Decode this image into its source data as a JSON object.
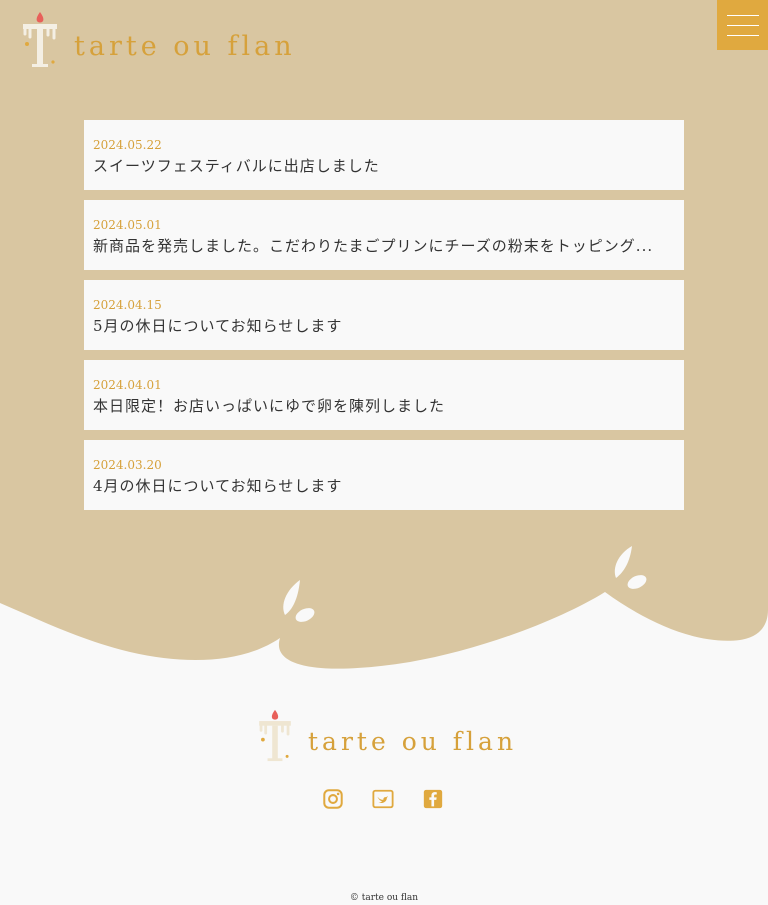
{
  "brand": {
    "name": "tarte ou flan",
    "accent": "#e0a93f",
    "gold_text": "#d6a13b",
    "background": "#d9c6a1",
    "footer_background": "#f9f9f9"
  },
  "header": {
    "menu_icon": "hamburger-icon"
  },
  "news": {
    "items": [
      {
        "date": "2024.05.22",
        "title": "スイーツフェスティバルに出店しました"
      },
      {
        "date": "2024.05.01",
        "title": "新商品を発売しました。こだわりたまごプリンにチーズの粉末をトッピング..."
      },
      {
        "date": "2024.04.15",
        "title": "5月の休日についてお知らせします"
      },
      {
        "date": "2024.04.01",
        "title": "本日限定！お店いっぱいにゆで卵を陳列しました"
      },
      {
        "date": "2024.03.20",
        "title": "4月の休日についてお知らせします"
      }
    ]
  },
  "footer": {
    "social": [
      "instagram-icon",
      "twitter-icon",
      "facebook-icon"
    ],
    "copyright": "© tarte ou flan"
  }
}
